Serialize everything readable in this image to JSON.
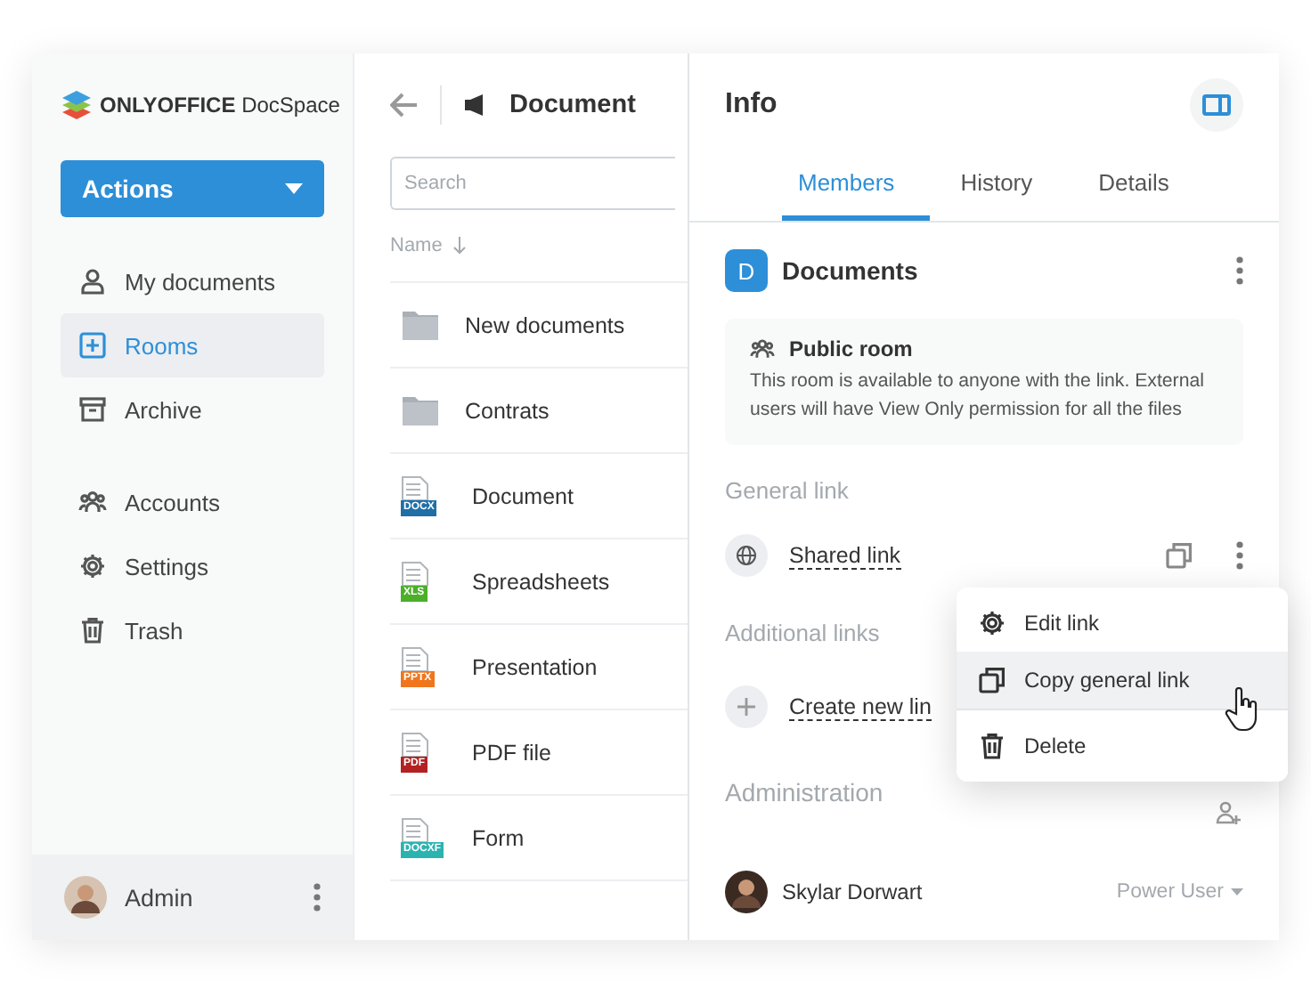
{
  "brand": {
    "name": "ONLYOFFICE",
    "product": "DocSpace"
  },
  "actions_button": {
    "label": "Actions"
  },
  "sidebar": {
    "items": [
      {
        "label": "My documents",
        "selected": false
      },
      {
        "label": "Rooms",
        "selected": true
      },
      {
        "label": "Archive",
        "selected": false
      },
      {
        "label": "Accounts",
        "selected": false
      },
      {
        "label": "Settings",
        "selected": false
      },
      {
        "label": "Trash",
        "selected": false
      }
    ],
    "user": {
      "name": "Admin"
    }
  },
  "files": {
    "title": "Document",
    "search": {
      "placeholder": "Search"
    },
    "column": "Name",
    "rows": [
      {
        "name": "New documents",
        "kind": "folder"
      },
      {
        "name": "Contrats",
        "kind": "folder"
      },
      {
        "name": "Document",
        "kind": "file",
        "type_label": "DOCX",
        "color": "#1e6fa8"
      },
      {
        "name": "Spreadsheets",
        "kind": "file",
        "type_label": "XLS",
        "color": "#4caf2a"
      },
      {
        "name": "Presentation",
        "kind": "file",
        "type_label": "PPTX",
        "color": "#f0761e"
      },
      {
        "name": "PDF file",
        "kind": "file",
        "type_label": "PDF",
        "color": "#b22222"
      },
      {
        "name": "Form",
        "kind": "file",
        "type_label": "DOCXF",
        "color": "#2bb3b0"
      }
    ]
  },
  "info": {
    "title": "Info",
    "tabs": [
      {
        "label": "Members",
        "selected": true
      },
      {
        "label": "History",
        "selected": false
      },
      {
        "label": "Details",
        "selected": false
      }
    ],
    "room": {
      "initial": "D",
      "name": "Documents"
    },
    "notice": {
      "title": "Public room",
      "text": "This room is available to anyone with the link. External users will have View Only permission for all the files"
    },
    "general_link": {
      "heading": "General link",
      "label": "Shared link"
    },
    "additional_links": {
      "heading": "Additional links",
      "label": "Create new lin"
    },
    "administration": {
      "heading": "Administration",
      "members": [
        {
          "name": "Skylar Dorwart",
          "role": "Power User"
        }
      ]
    },
    "menu": [
      {
        "label": "Edit link",
        "selected": false
      },
      {
        "label": "Copy general link",
        "selected": true
      },
      {
        "label": "Delete",
        "selected": false
      }
    ]
  }
}
